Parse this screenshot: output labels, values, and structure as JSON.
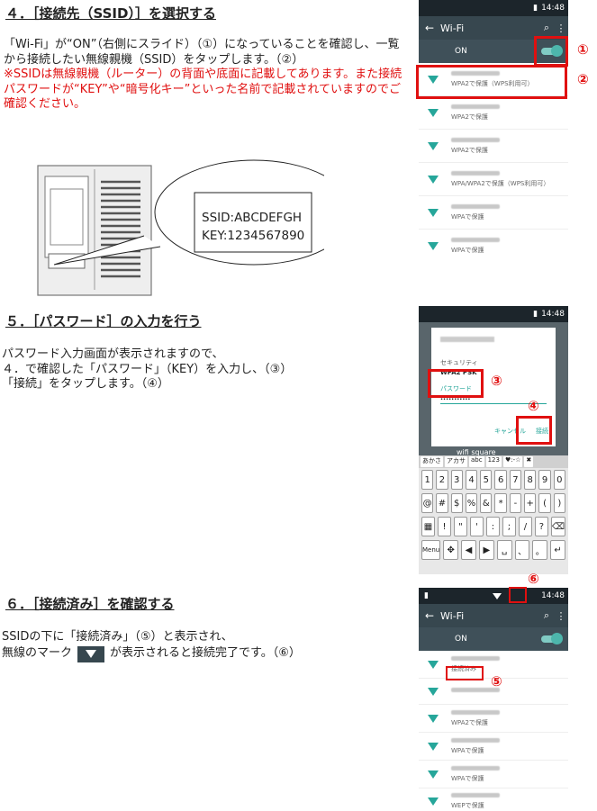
{
  "section4": {
    "heading": "４．［接続先（SSID）］を選択する",
    "para_black": "「Wi-Fi」が“ON”（右側にスライド）（①）になっていることを確認し、一覧から接続したい無線親機（SSID）をタップします。（②）",
    "para_red": "※SSIDは無線親機（ルーター）の背面や底面に記載してあります。また接続パスワードが“KEY”や“暗号化キー”といった名前で記載されていますのでご確認ください。",
    "bubble_ssid": "SSID:ABCDEFGH",
    "bubble_key": "KEY:1234567890"
  },
  "section5": {
    "heading": "５．［パスワード］の入力を行う",
    "line1": "パスワード入力画面が表示されますので、",
    "line2": "４．で確認した「パスワード」（KEY）を入力し、（③）",
    "line3": "「接続」をタップします。（④）"
  },
  "section6": {
    "heading": "６．［接続済み］を確認する",
    "line1": "SSIDの下に「接続済み」（⑤）と表示され、",
    "line2a": "無線のマーク",
    "line2b": "が表示されると接続完了です。（⑥）"
  },
  "phone1": {
    "time": "14:48",
    "title": "Wi-Fi",
    "on_label": "ON",
    "networks": [
      {
        "status": "WPA2で保護（WPS利用可）"
      },
      {
        "status": "WPA2で保護"
      },
      {
        "status": "WPA2で保護"
      },
      {
        "status": "WPA/WPA2で保護（WPS利用可）"
      },
      {
        "status": "WPAで保護"
      },
      {
        "status": "WPAで保護"
      }
    ],
    "marker1": "①",
    "marker2": "②"
  },
  "phone2": {
    "time": "14:48",
    "security_label": "セキュリティ",
    "security_value": "WPA2 PSK",
    "password_label": "パスワード",
    "password_value": "···········",
    "cancel": "キャンセル",
    "connect": "接続",
    "bg_network": "wifi square",
    "kb_tabs": [
      "あかさ",
      "アカサ",
      "abc",
      "123",
      "♥:-☆",
      "✖"
    ],
    "kb_row1": [
      "1",
      "2",
      "3",
      "4",
      "5",
      "6",
      "7",
      "8",
      "9",
      "0"
    ],
    "kb_row2": [
      "@",
      "#",
      "$",
      "%",
      "&",
      "*",
      "-",
      "+",
      "(",
      ")"
    ],
    "kb_row3": [
      "▦",
      "!",
      "\"",
      "'",
      ":",
      ";",
      "/",
      "?",
      "⌫"
    ],
    "kb_row4": [
      "Menu",
      "✥",
      "◀",
      "▶",
      "␣",
      "、",
      "。",
      "↵"
    ],
    "marker3": "③",
    "marker4": "④"
  },
  "phone3": {
    "time": "14:48",
    "title": "Wi-Fi",
    "on_label": "ON",
    "networks": [
      {
        "status": "接続済み"
      },
      {
        "status": ""
      },
      {
        "status": "WPA2で保護"
      },
      {
        "status": "WPAで保護"
      },
      {
        "status": "WPAで保護"
      },
      {
        "status": "WEPで保護"
      }
    ],
    "marker5": "⑤",
    "marker6": "⑥"
  },
  "colors": {
    "red": "#e01010",
    "teal": "#26a69a",
    "appbar": "#37474f"
  }
}
